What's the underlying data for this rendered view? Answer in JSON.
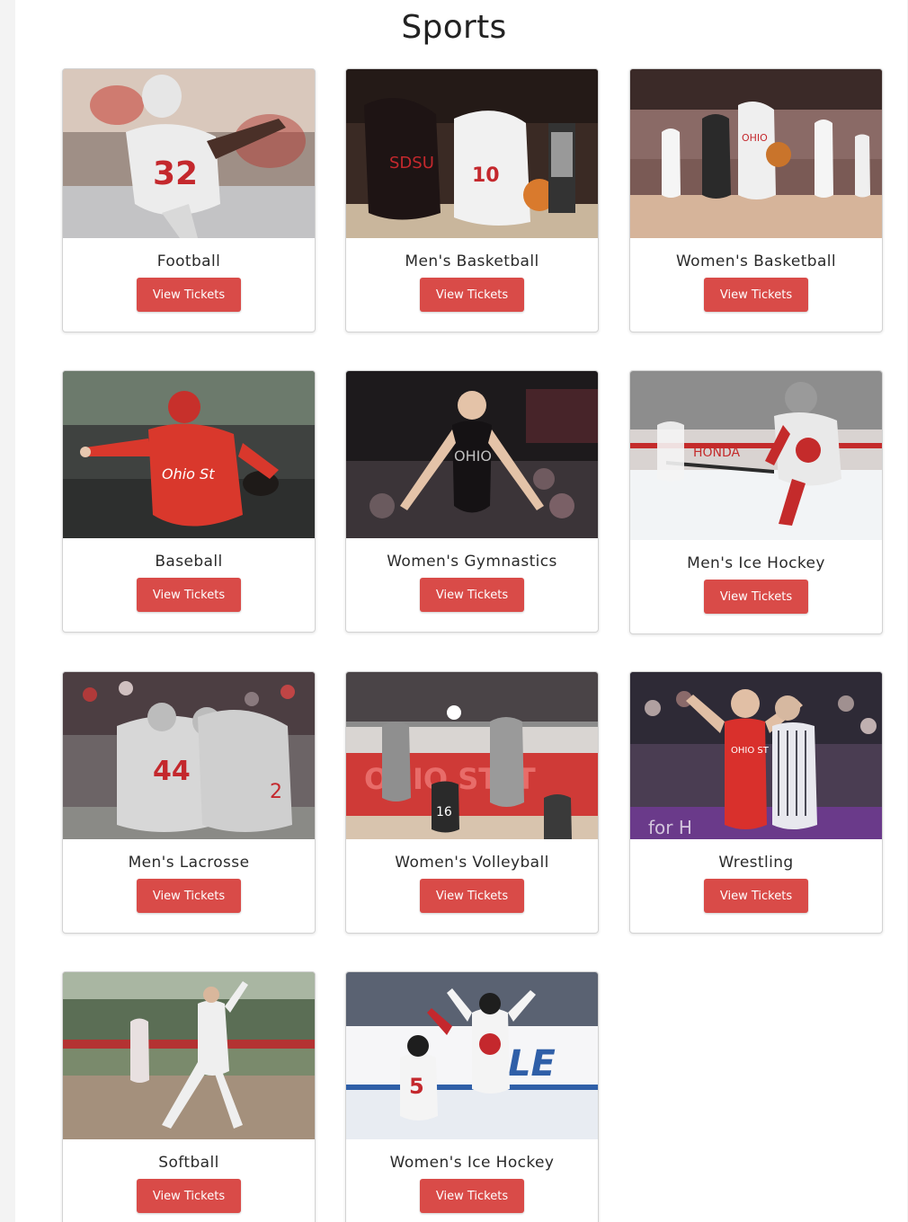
{
  "page": {
    "title": "Sports"
  },
  "accent_color": "#d94b48",
  "sports": [
    {
      "name": "Football",
      "button": "View Tickets",
      "photo": "football-player-photo"
    },
    {
      "name": "Men's Basketball",
      "button": "View Tickets",
      "photo": "mens-basketball-photo"
    },
    {
      "name": "Women's Basketball",
      "button": "View Tickets",
      "photo": "womens-basketball-photo"
    },
    {
      "name": "Baseball",
      "button": "View Tickets",
      "photo": "baseball-pitcher-photo"
    },
    {
      "name": "Women's Gymnastics",
      "button": "View Tickets",
      "photo": "womens-gymnastics-photo"
    },
    {
      "name": "Men's Ice Hockey",
      "button": "View Tickets",
      "photo": "mens-ice-hockey-photo"
    },
    {
      "name": "Men's Lacrosse",
      "button": "View Tickets",
      "photo": "mens-lacrosse-photo"
    },
    {
      "name": "Women's Volleyball",
      "button": "View Tickets",
      "photo": "womens-volleyball-photo"
    },
    {
      "name": "Wrestling",
      "button": "View Tickets",
      "photo": "wrestling-photo"
    },
    {
      "name": "Softball",
      "button": "View Tickets",
      "photo": "softball-pitcher-photo"
    },
    {
      "name": "Women's Ice Hockey",
      "button": "View Tickets",
      "photo": "womens-ice-hockey-photo"
    }
  ]
}
